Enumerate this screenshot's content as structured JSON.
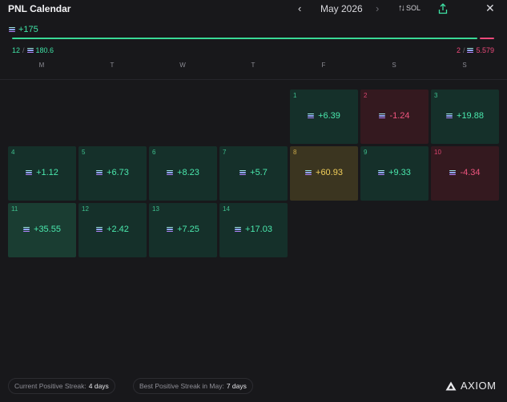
{
  "header": {
    "title": "PNL Calendar",
    "prev_icon": "chevron-left-icon",
    "month": "May 2026",
    "next_icon": "chevron-right-icon",
    "currency_icon": "swap-arrows-icon",
    "currency": "SOL",
    "share_icon": "share-upload-icon",
    "close_icon": "close-icon"
  },
  "summary": {
    "total": "+175",
    "win_fraction": 0.97,
    "wins": {
      "count": "12",
      "sep": "/",
      "amount": "180.6"
    },
    "losses": {
      "count": "2",
      "sep": "/",
      "amount": "5.579"
    },
    "colors": {
      "positive": "#39d996",
      "negative": "#ef4a7b"
    }
  },
  "weekdays": [
    "M",
    "T",
    "W",
    "T",
    "F",
    "S",
    "S"
  ],
  "days": [
    {
      "day": "1",
      "value": "+6.39",
      "type": "pos",
      "col": 4,
      "row": 0
    },
    {
      "day": "2",
      "value": "-1.24",
      "type": "neg",
      "col": 5,
      "row": 0
    },
    {
      "day": "3",
      "value": "+19.88",
      "type": "pos",
      "col": 6,
      "row": 0
    },
    {
      "day": "4",
      "value": "+1.12",
      "type": "pos",
      "col": 0,
      "row": 1
    },
    {
      "day": "5",
      "value": "+6.73",
      "type": "pos",
      "col": 1,
      "row": 1
    },
    {
      "day": "6",
      "value": "+8.23",
      "type": "pos",
      "col": 2,
      "row": 1
    },
    {
      "day": "7",
      "value": "+5.7",
      "type": "pos",
      "col": 3,
      "row": 1
    },
    {
      "day": "8",
      "value": "+60.93",
      "type": "big",
      "col": 4,
      "row": 1
    },
    {
      "day": "9",
      "value": "+9.33",
      "type": "pos",
      "col": 5,
      "row": 1
    },
    {
      "day": "10",
      "value": "-4.34",
      "type": "neg",
      "col": 6,
      "row": 1
    },
    {
      "day": "11",
      "value": "+35.55",
      "type": "pos strong",
      "col": 0,
      "row": 2
    },
    {
      "day": "12",
      "value": "+2.42",
      "type": "pos",
      "col": 1,
      "row": 2
    },
    {
      "day": "13",
      "value": "+7.25",
      "type": "pos",
      "col": 2,
      "row": 2
    },
    {
      "day": "14",
      "value": "+17.03",
      "type": "pos",
      "col": 3,
      "row": 2
    }
  ],
  "footer": {
    "current_streak": {
      "label": "Current Positive Streak:",
      "value": "4 days"
    },
    "best_streak": {
      "label": "Best Positive Streak in May:",
      "value": "7 days"
    },
    "brand": "AXIOM",
    "brand_icon": "axiom-logo-icon"
  }
}
